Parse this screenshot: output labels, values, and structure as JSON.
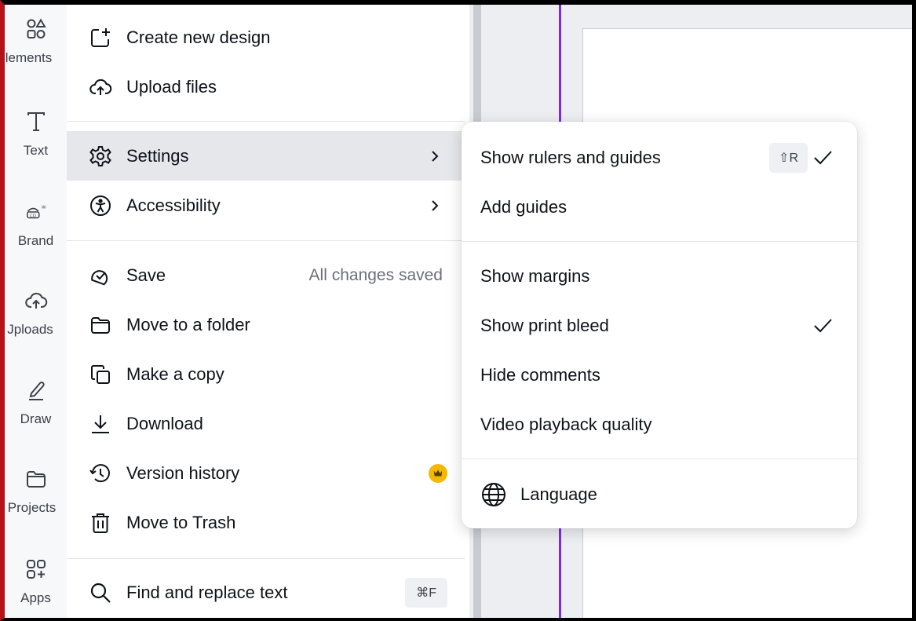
{
  "rail": {
    "items": [
      {
        "label": "lements",
        "icon": "elements-icon"
      },
      {
        "label": "Text",
        "icon": "text-icon"
      },
      {
        "label": "Brand",
        "icon": "brand-icon"
      },
      {
        "label": "Jploads",
        "icon": "upload-cloud-icon"
      },
      {
        "label": "Draw",
        "icon": "draw-icon"
      },
      {
        "label": "Projects",
        "icon": "folder-icon"
      },
      {
        "label": "Apps",
        "icon": "apps-icon"
      }
    ]
  },
  "menu": {
    "create": "Create new design",
    "upload": "Upload files",
    "settings": "Settings",
    "accessibility": "Accessibility",
    "save": "Save",
    "save_status": "All changes saved",
    "move_folder": "Move to a folder",
    "copy": "Make a copy",
    "download": "Download",
    "version": "Version history",
    "trash": "Move to Trash",
    "find": "Find and replace text",
    "find_shortcut": "⌘F"
  },
  "submenu": {
    "rulers": "Show rulers and guides",
    "rulers_shortcut": "⇧R",
    "guides": "Add guides",
    "margins": "Show margins",
    "bleed": "Show print bleed",
    "comments": "Hide comments",
    "video": "Video playback quality",
    "language": "Language"
  },
  "colors": {
    "accent": "#7d2ae8",
    "premium": "#f5b800",
    "active_bg": "#e6e7eb"
  }
}
